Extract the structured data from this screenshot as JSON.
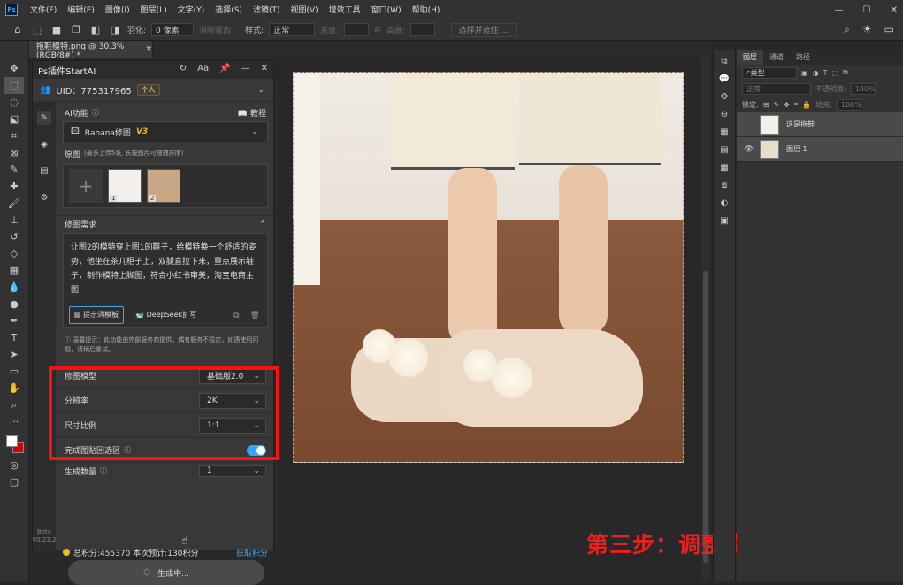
{
  "app": {
    "logo": "Ps"
  },
  "menu": [
    "文件(F)",
    "编辑(E)",
    "图像(I)",
    "图层(L)",
    "文字(Y)",
    "选择(S)",
    "滤镜(T)",
    "视图(V)",
    "增效工具",
    "窗口(W)",
    "帮助(H)"
  ],
  "options": {
    "feather_label": "羽化:",
    "feather_value": "0 像素",
    "antialias": "消除锯齿",
    "style_label": "样式:",
    "style_value": "正常",
    "width_label": "宽度:",
    "height_label": "高度:",
    "select_mask": "选择并遮住 ..."
  },
  "document": {
    "tab": "拖鞋模特.png @ 30.3%(RGB/8#) *"
  },
  "toolbar": {
    "version": "Beta\nV0.23.2"
  },
  "plugin": {
    "title": "Ps插件StartAI",
    "uid": "UID：775317965",
    "badge": "个人",
    "ai_function": "AI功能",
    "tutorial": "教程",
    "model_select": "Banana修图",
    "model_badge": "V3",
    "original_label": "原图",
    "original_hint": "(最多上传5张, 长按图片可拖拽排序)",
    "img1_num": "1",
    "img2_num": "2",
    "requirement_label": "修图需求",
    "prompt": "让图2的模特穿上图1的鞋子，给模特换一个舒适的姿势，他坐在茶几柜子上，双腿直拉下来，重点展示鞋子，制作模特上脚图，符合小红书审美，淘宝电商主图",
    "prompt_template": "提示词模板",
    "deepseek": "DeepSeek扩写",
    "notice": "温馨提示：此功能由外部服务商提供，偶有服务不稳定，如遇使用问题，请稍后重试。",
    "params": [
      {
        "label": "修图模型",
        "value": "基础版2.0"
      },
      {
        "label": "分辨率",
        "value": "2K"
      },
      {
        "label": "尺寸比例",
        "value": "1:1"
      }
    ],
    "paste_back": "完成图贴回选区",
    "gen_count_label": "生成数量",
    "gen_count_value": "1",
    "points": "总积分:455370  本次预计:130积分",
    "get_points": "获取积分",
    "generating": "生成中..."
  },
  "layers": {
    "tabs": [
      "图层",
      "通道",
      "路径"
    ],
    "filter": "类型",
    "blend": "正常",
    "opacity_label": "不透明度:",
    "opacity_value": "100%",
    "lock_label": "锁定:",
    "fill_label": "填充:",
    "fill_value": "100%",
    "items": [
      {
        "name": "这是拖鞋",
        "visible": false
      },
      {
        "name": "图层 1",
        "visible": true
      }
    ]
  },
  "caption": "第三步：调整模型参数设置",
  "colors": {
    "accent": "#31a8ff",
    "highlight": "#ff1010",
    "caption": "#e82020"
  }
}
